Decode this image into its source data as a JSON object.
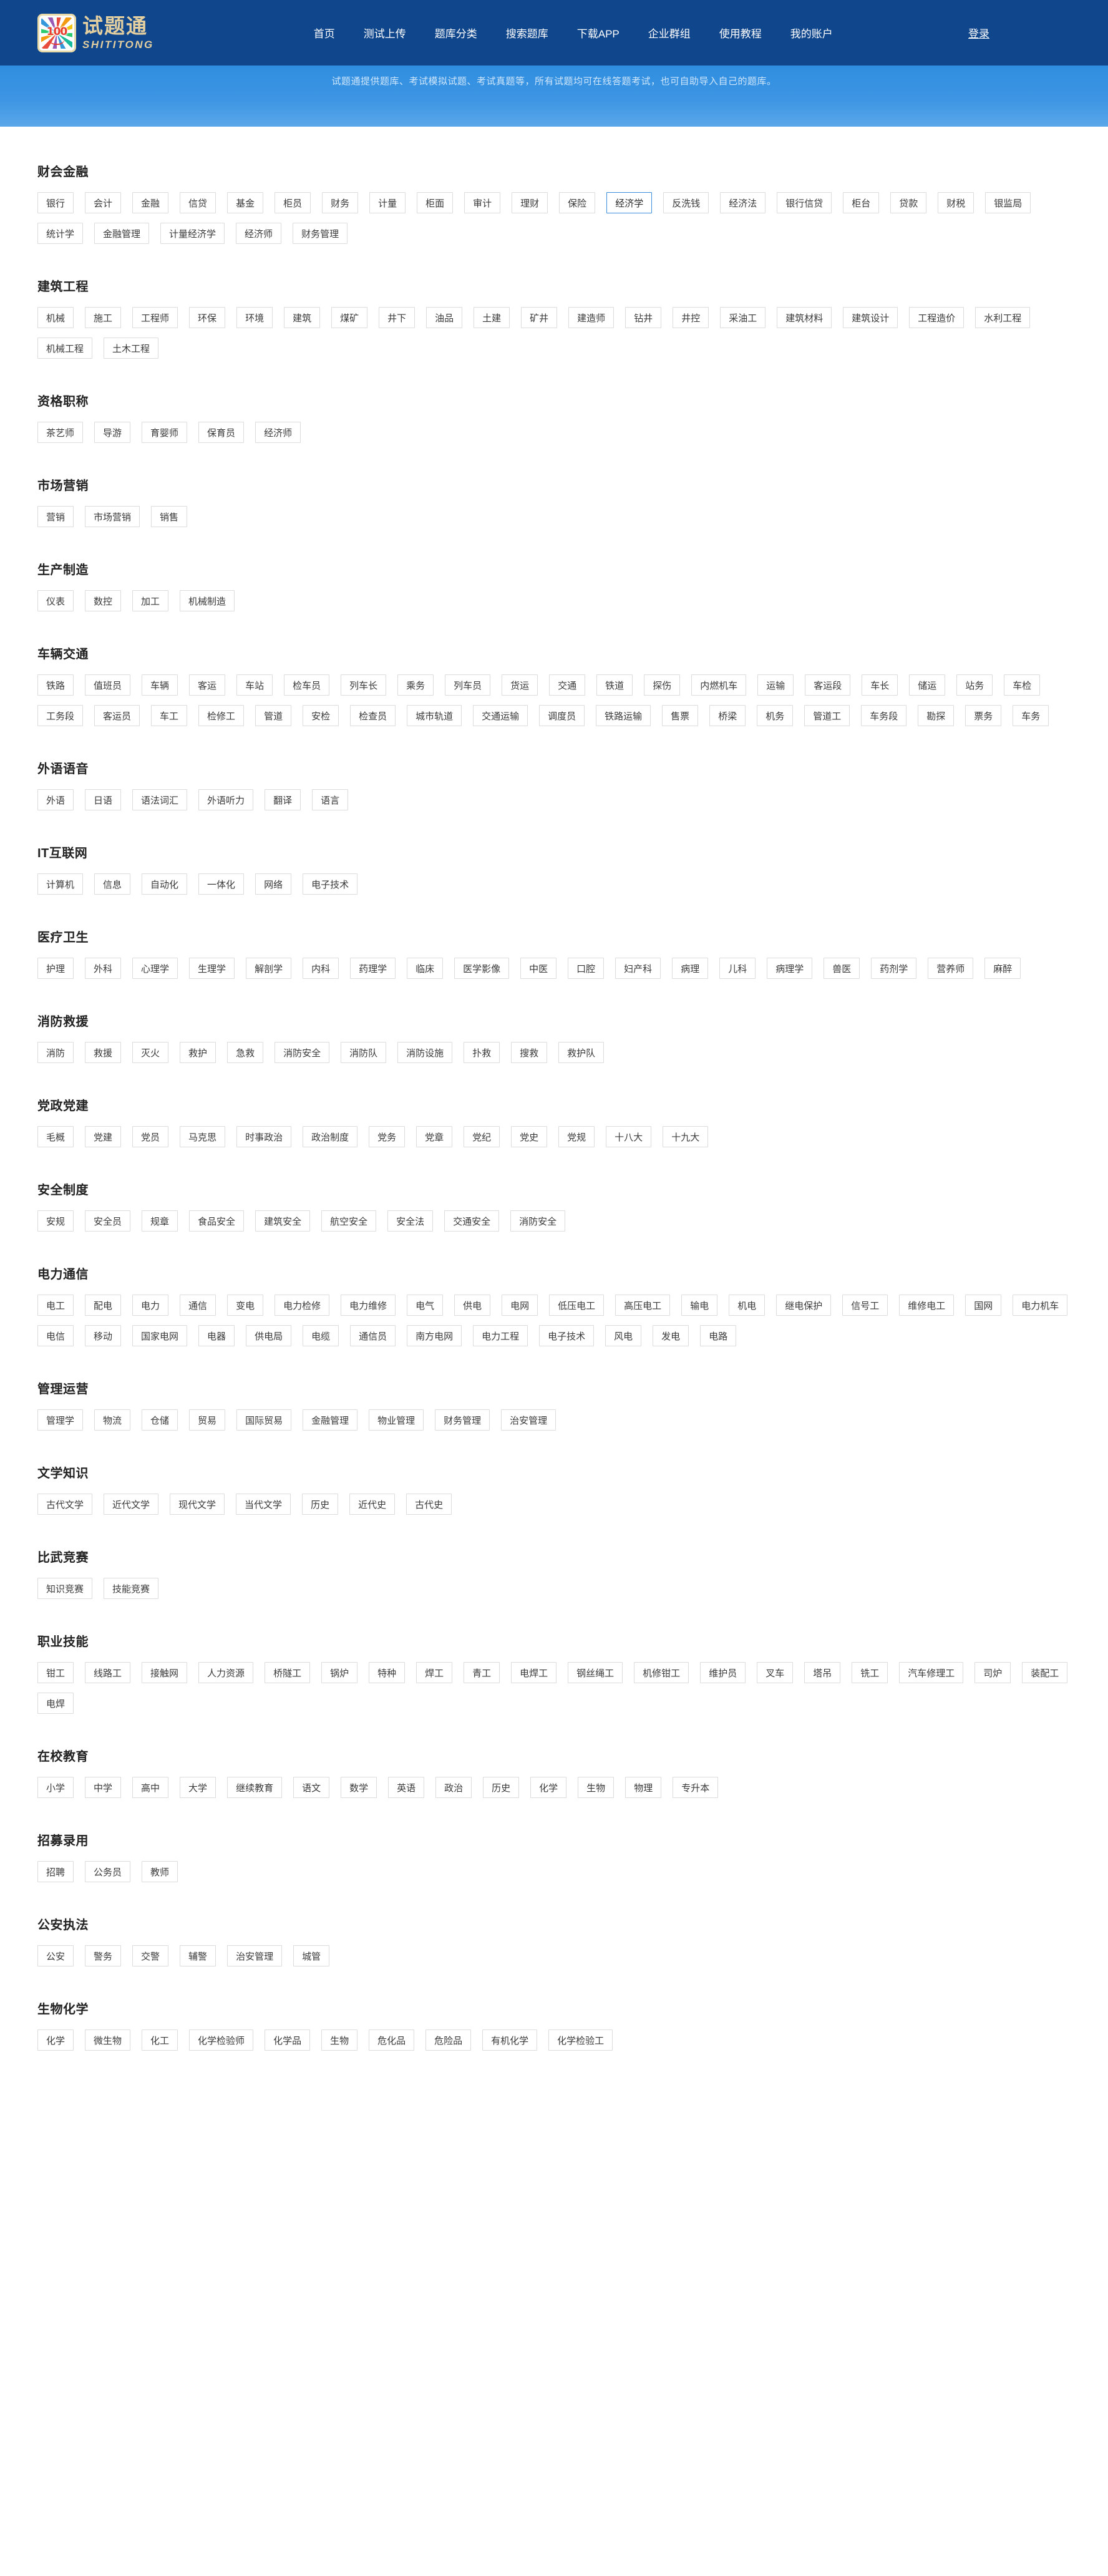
{
  "header": {
    "brand_cn": "试题通",
    "brand_en": "SHITITONG",
    "brand_badge": "100",
    "nav": [
      {
        "label": "首页"
      },
      {
        "label": "测试上传"
      },
      {
        "label": "题库分类"
      },
      {
        "label": "搜索题库"
      },
      {
        "label": "下载APP"
      },
      {
        "label": "企业群组"
      },
      {
        "label": "使用教程"
      },
      {
        "label": "我的账户"
      }
    ],
    "login_label": "登录",
    "brand_color": "#10468c",
    "brand_accent": "#e3cfa0"
  },
  "banner": {
    "text": "试题通提供题库、考试模拟试题、考试真题等，所有试题均可在线答题考试，也可自助导入自己的题库。",
    "bg_top": "#2f8ee0",
    "bg_bottom": "#59a7ea",
    "text_color": "#cfe6fb"
  },
  "active_tag": "经济学",
  "active_border_color": "#3c8ede",
  "categories": [
    {
      "title": "财会金融",
      "tags": [
        "银行",
        "会计",
        "金融",
        "信贷",
        "基金",
        "柜员",
        "财务",
        "计量",
        "柜面",
        "审计",
        "理财",
        "保险",
        "经济学",
        "反洗钱",
        "经济法",
        "银行信贷",
        "柜台",
        "贷款",
        "财税",
        "银监局",
        "统计学",
        "金融管理",
        "计量经济学",
        "经济师",
        "财务管理"
      ]
    },
    {
      "title": "建筑工程",
      "tags": [
        "机械",
        "施工",
        "工程师",
        "环保",
        "环境",
        "建筑",
        "煤矿",
        "井下",
        "油品",
        "土建",
        "矿井",
        "建造师",
        "钻井",
        "井控",
        "采油工",
        "建筑材料",
        "建筑设计",
        "工程造价",
        "水利工程",
        "机械工程",
        "土木工程"
      ]
    },
    {
      "title": "资格职称",
      "tags": [
        "茶艺师",
        "导游",
        "育婴师",
        "保育员",
        "经济师"
      ]
    },
    {
      "title": "市场营销",
      "tags": [
        "营销",
        "市场营销",
        "销售"
      ]
    },
    {
      "title": "生产制造",
      "tags": [
        "仪表",
        "数控",
        "加工",
        "机械制造"
      ]
    },
    {
      "title": "车辆交通",
      "tags": [
        "铁路",
        "值班员",
        "车辆",
        "客运",
        "车站",
        "检车员",
        "列车长",
        "乘务",
        "列车员",
        "货运",
        "交通",
        "铁道",
        "探伤",
        "内燃机车",
        "运输",
        "客运段",
        "车长",
        "储运",
        "站务",
        "车检",
        "工务段",
        "客运员",
        "车工",
        "检修工",
        "管道",
        "安检",
        "检查员",
        "城市轨道",
        "交通运输",
        "调度员",
        "铁路运输",
        "售票",
        "桥梁",
        "机务",
        "管道工",
        "车务段",
        "勘探",
        "票务",
        "车务"
      ]
    },
    {
      "title": "外语语音",
      "tags": [
        "外语",
        "日语",
        "语法词汇",
        "外语听力",
        "翻译",
        "语言"
      ]
    },
    {
      "title": "IT互联网",
      "tags": [
        "计算机",
        "信息",
        "自动化",
        "一体化",
        "网络",
        "电子技术"
      ]
    },
    {
      "title": "医疗卫生",
      "tags": [
        "护理",
        "外科",
        "心理学",
        "生理学",
        "解剖学",
        "内科",
        "药理学",
        "临床",
        "医学影像",
        "中医",
        "口腔",
        "妇产科",
        "病理",
        "儿科",
        "病理学",
        "兽医",
        "药剂学",
        "营养师",
        "麻醉"
      ]
    },
    {
      "title": "消防救援",
      "tags": [
        "消防",
        "救援",
        "灭火",
        "救护",
        "急救",
        "消防安全",
        "消防队",
        "消防设施",
        "扑救",
        "搜救",
        "救护队"
      ]
    },
    {
      "title": "党政党建",
      "tags": [
        "毛概",
        "党建",
        "党员",
        "马克思",
        "时事政治",
        "政治制度",
        "党务",
        "党章",
        "党纪",
        "党史",
        "党规",
        "十八大",
        "十九大"
      ]
    },
    {
      "title": "安全制度",
      "tags": [
        "安规",
        "安全员",
        "规章",
        "食品安全",
        "建筑安全",
        "航空安全",
        "安全法",
        "交通安全",
        "消防安全"
      ]
    },
    {
      "title": "电力通信",
      "tags": [
        "电工",
        "配电",
        "电力",
        "通信",
        "变电",
        "电力检修",
        "电力维修",
        "电气",
        "供电",
        "电网",
        "低压电工",
        "高压电工",
        "输电",
        "机电",
        "继电保护",
        "信号工",
        "维修电工",
        "国网",
        "电力机车",
        "电信",
        "移动",
        "国家电网",
        "电器",
        "供电局",
        "电缆",
        "通信员",
        "南方电网",
        "电力工程",
        "电子技术",
        "风电",
        "发电",
        "电路"
      ]
    },
    {
      "title": "管理运营",
      "tags": [
        "管理学",
        "物流",
        "仓储",
        "贸易",
        "国际贸易",
        "金融管理",
        "物业管理",
        "财务管理",
        "治安管理"
      ]
    },
    {
      "title": "文学知识",
      "tags": [
        "古代文学",
        "近代文学",
        "现代文学",
        "当代文学",
        "历史",
        "近代史",
        "古代史"
      ]
    },
    {
      "title": "比武竞赛",
      "tags": [
        "知识竞赛",
        "技能竞赛"
      ]
    },
    {
      "title": "职业技能",
      "tags": [
        "钳工",
        "线路工",
        "接触网",
        "人力资源",
        "桥隧工",
        "锅炉",
        "特种",
        "焊工",
        "青工",
        "电焊工",
        "钢丝绳工",
        "机修钳工",
        "维护员",
        "叉车",
        "塔吊",
        "铣工",
        "汽车修理工",
        "司炉",
        "装配工",
        "电焊"
      ]
    },
    {
      "title": "在校教育",
      "tags": [
        "小学",
        "中学",
        "高中",
        "大学",
        "继续教育",
        "语文",
        "数学",
        "英语",
        "政治",
        "历史",
        "化学",
        "生物",
        "物理",
        "专升本"
      ]
    },
    {
      "title": "招募录用",
      "tags": [
        "招聘",
        "公务员",
        "教师"
      ]
    },
    {
      "title": "公安执法",
      "tags": [
        "公安",
        "警务",
        "交警",
        "辅警",
        "治安管理",
        "城管"
      ]
    },
    {
      "title": "生物化学",
      "tags": [
        "化学",
        "微生物",
        "化工",
        "化学检验师",
        "化学品",
        "生物",
        "危化品",
        "危险品",
        "有机化学",
        "化学检验工"
      ]
    }
  ]
}
